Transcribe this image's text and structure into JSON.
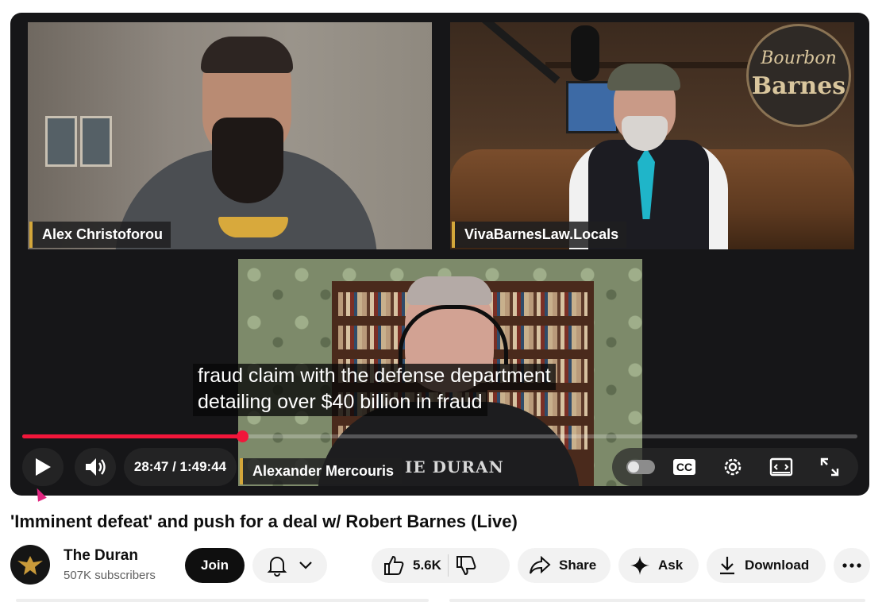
{
  "video": {
    "participants": {
      "top_left": "Alex Christoforou",
      "top_right": "VivaBarnesLaw.Locals",
      "bottom": "Alexander Mercouris"
    },
    "background_sign": {
      "line1": "Bourbon",
      "line2": "Barnes"
    },
    "shirt_text": "IE DURAN",
    "captions": [
      "fraud claim with the defense department",
      "detailing over $40 billion in fraud"
    ],
    "progress_fraction": 0.263,
    "time": "28:47 / 1:49:44",
    "controls": {
      "play_icon": "play-icon",
      "volume_icon": "volume-icon",
      "autoplay_icon": "autoplay-toggle-icon",
      "cc_label": "CC",
      "settings_icon": "gear-icon",
      "miniplayer_icon": "miniplayer-icon",
      "fullscreen_icon": "fullscreen-icon"
    }
  },
  "title": "'Imminent defeat' and push for a deal w/ Robert Barnes (Live)",
  "channel": {
    "name": "The Duran",
    "subscribers": "507K subscribers",
    "join_label": "Join"
  },
  "actions": {
    "likes": "5.6K",
    "share": "Share",
    "ask": "Ask",
    "download": "Download"
  },
  "colors": {
    "progress": "#f2163a",
    "name_accent": "#d4a73a",
    "cursor": "#e0257f"
  }
}
